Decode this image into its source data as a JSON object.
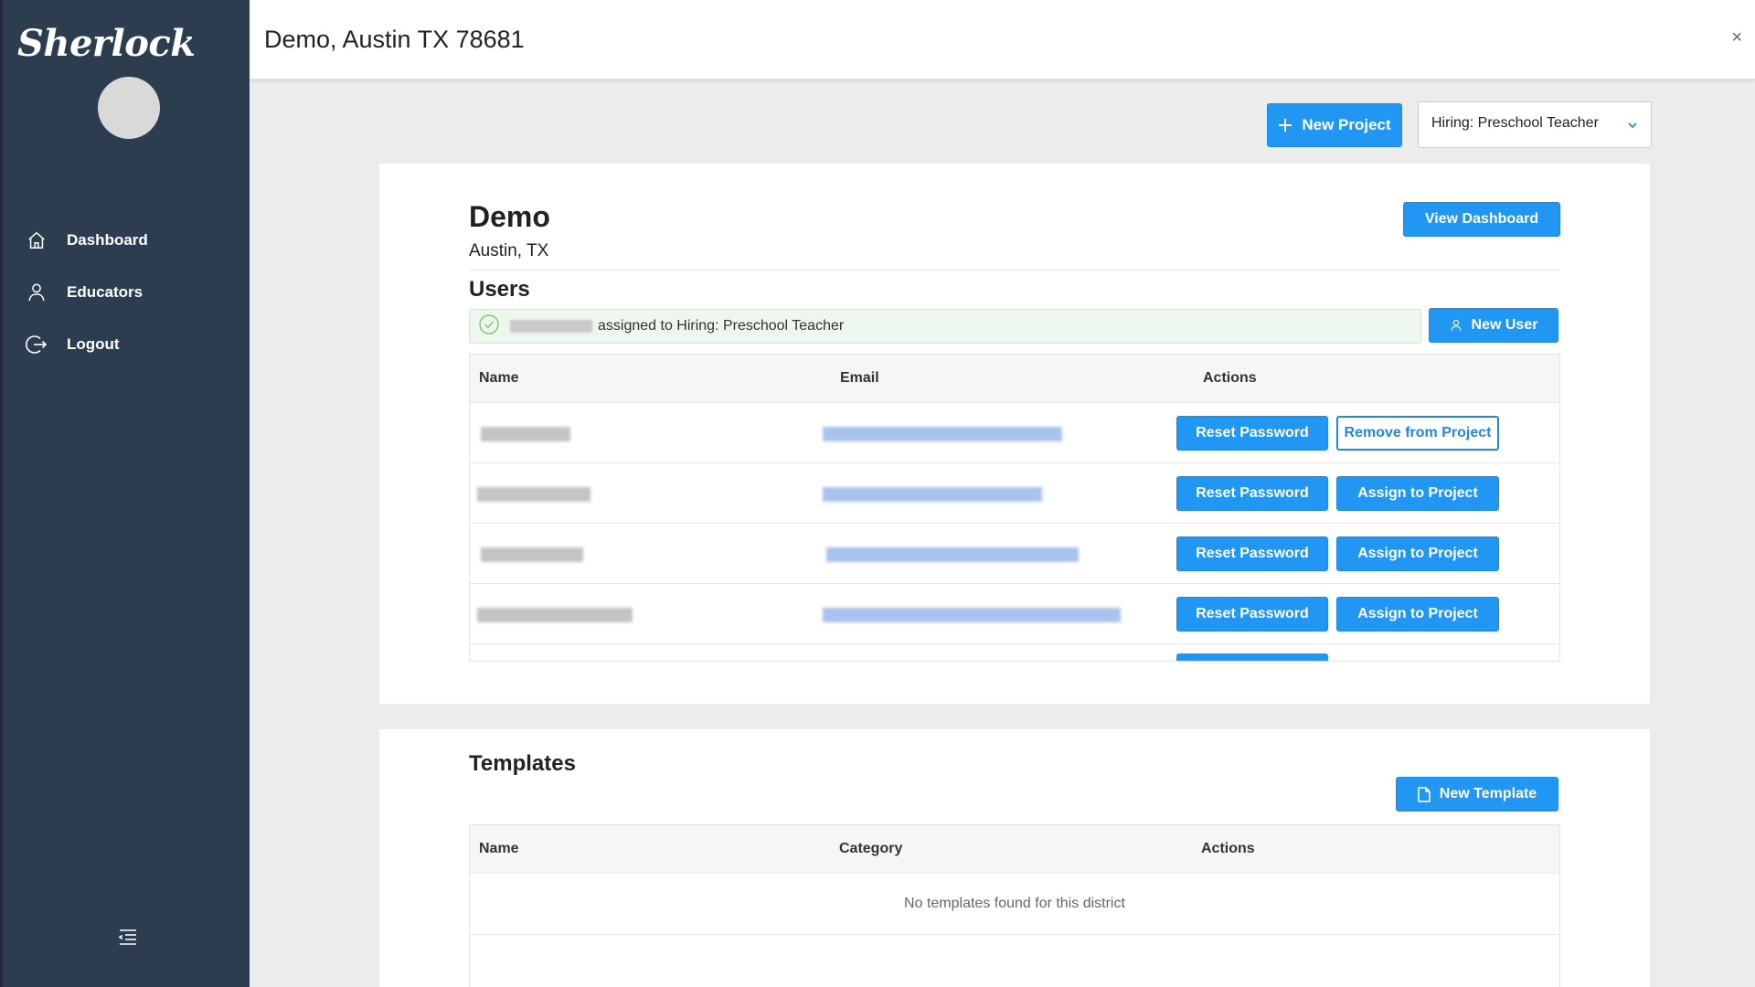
{
  "app": {
    "logo": "Sherlock"
  },
  "sidebar": {
    "items": [
      {
        "label": "Dashboard",
        "icon": "home-icon"
      },
      {
        "label": "Educators",
        "icon": "user-icon"
      },
      {
        "label": "Logout",
        "icon": "logout-icon"
      }
    ]
  },
  "topbar": {
    "title": "Demo, Austin TX 78681",
    "close": "×"
  },
  "controls": {
    "new_project_label": "New Project",
    "project_selected": "Hiring: Preschool Teacher"
  },
  "district": {
    "name": "Demo",
    "location": "Austin, TX",
    "view_dashboard_label": "View Dashboard"
  },
  "users": {
    "heading": "Users",
    "alert_text": "assigned to Hiring: Preschool Teacher",
    "new_user_label": "New User",
    "columns": [
      "Name",
      "Email",
      "Actions"
    ],
    "rows": [
      {
        "action1": "Reset Password",
        "action2": "Remove from Project",
        "assigned": true
      },
      {
        "action1": "Reset Password",
        "action2": "Assign to Project",
        "assigned": false
      },
      {
        "action1": "Reset Password",
        "action2": "Assign to Project",
        "assigned": false
      },
      {
        "action1": "Reset Password",
        "action2": "Assign to Project",
        "assigned": false
      }
    ]
  },
  "templates": {
    "heading": "Templates",
    "new_template_label": "New Template",
    "columns": [
      "Name",
      "Category",
      "Actions"
    ],
    "empty_message": "No templates found for this district"
  },
  "colors": {
    "sidebar": "#2c3d50",
    "primary": "#2196f3",
    "success_bg": "#eef7ee"
  }
}
